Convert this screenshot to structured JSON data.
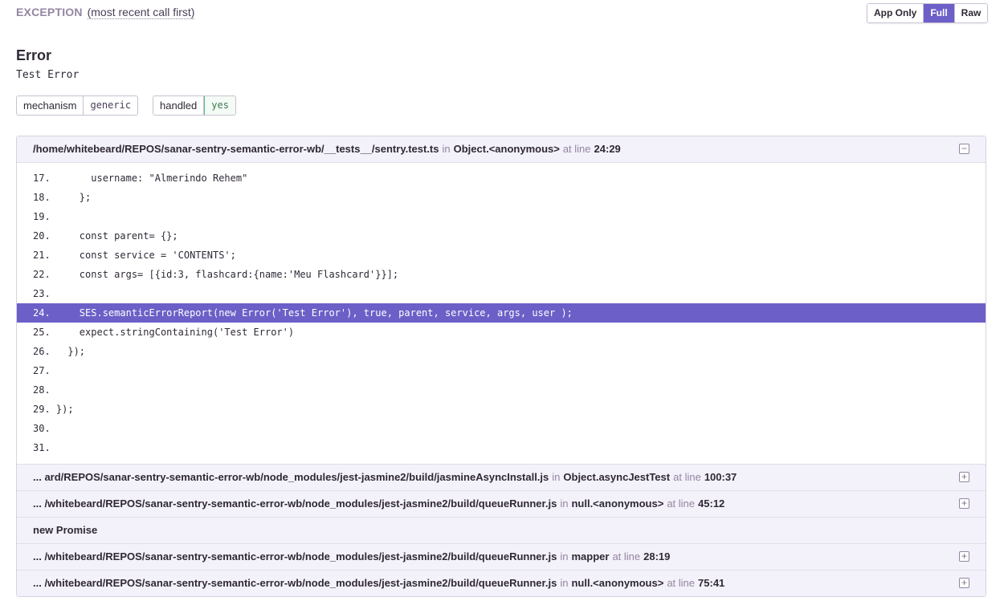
{
  "header": {
    "title": "EXCEPTION",
    "subtitle": "(most recent call first)"
  },
  "view_toggle": {
    "options": [
      "App Only",
      "Full",
      "Raw"
    ],
    "active": "Full"
  },
  "error": {
    "type": "Error",
    "value": "Test Error"
  },
  "tags": [
    {
      "key": "mechanism",
      "value": "generic"
    },
    {
      "key": "handled",
      "value": "yes"
    }
  ],
  "frames": {
    "labels": {
      "in": "in",
      "at_line": "at line"
    },
    "first": {
      "file": "/home/whitebeard/REPOS/sanar-sentry-semantic-error-wb/__tests__/sentry.test.ts",
      "function": "Object.<anonymous>",
      "line": "24:29",
      "toggle": "−"
    },
    "code_lines": [
      {
        "num": "17.",
        "code": "      username: \"Almerindo Rehem\""
      },
      {
        "num": "18.",
        "code": "    };"
      },
      {
        "num": "19.",
        "code": ""
      },
      {
        "num": "20.",
        "code": "    const parent= {};"
      },
      {
        "num": "21.",
        "code": "    const service = 'CONTENTS';"
      },
      {
        "num": "22.",
        "code": "    const args= [{id:3, flashcard:{name:'Meu Flashcard'}}];"
      },
      {
        "num": "23.",
        "code": ""
      },
      {
        "num": "24.",
        "code": "    SES.semanticErrorReport(new Error('Test Error'), true, parent, service, args, user );"
      },
      {
        "num": "25.",
        "code": "    expect.stringContaining('Test Error')"
      },
      {
        "num": "26.",
        "code": "  });"
      },
      {
        "num": "27.",
        "code": ""
      },
      {
        "num": "28.",
        "code": ""
      },
      {
        "num": "29.",
        "code": "});"
      },
      {
        "num": "30.",
        "code": ""
      },
      {
        "num": "31.",
        "code": ""
      }
    ],
    "f2": {
      "file": "... ard/REPOS/sanar-sentry-semantic-error-wb/node_modules/jest-jasmine2/build/jasmineAsyncInstall.js",
      "function": "Object.asyncJestTest",
      "line": "100:37",
      "toggle": "+"
    },
    "f3": {
      "file": "... /whitebeard/REPOS/sanar-sentry-semantic-error-wb/node_modules/jest-jasmine2/build/queueRunner.js",
      "function": "null.<anonymous>",
      "line": "45:12",
      "toggle": "+"
    },
    "f4": {
      "label": "new Promise"
    },
    "f5": {
      "file": "... /whitebeard/REPOS/sanar-sentry-semantic-error-wb/node_modules/jest-jasmine2/build/queueRunner.js",
      "function": "mapper",
      "line": "28:19",
      "toggle": "+"
    },
    "f6": {
      "file": "... /whitebeard/REPOS/sanar-sentry-semantic-error-wb/node_modules/jest-jasmine2/build/queueRunner.js",
      "function": "null.<anonymous>",
      "line": "75:41",
      "toggle": "+"
    }
  },
  "colors": {
    "accent": "#6c5fc7",
    "muted": "#9585a3",
    "tag_green": "#57be8c"
  }
}
